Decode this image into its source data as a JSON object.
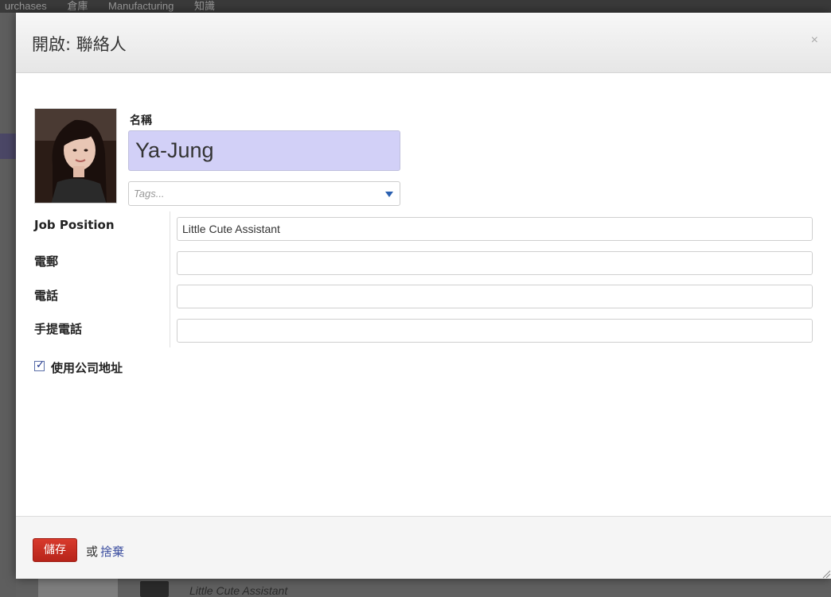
{
  "background": {
    "menu_items": [
      "urchases",
      "倉庫",
      "Manufacturing",
      "知識"
    ],
    "card_subtitle": "Little Cute Assistant"
  },
  "dialog": {
    "title": "開啟: 聯絡人",
    "close_label": "×"
  },
  "form": {
    "name_label": "名稱",
    "name_value": "Ya-Jung",
    "tags_placeholder": "Tags...",
    "fields": [
      {
        "label": "Job Position",
        "value": "Little Cute Assistant"
      },
      {
        "label": "電郵",
        "value": ""
      },
      {
        "label": "電話",
        "value": ""
      },
      {
        "label": "手提電話",
        "value": ""
      }
    ],
    "use_company_address": {
      "label": "使用公司地址",
      "checked": true
    }
  },
  "footer": {
    "save_label": "儲存",
    "or_text": "或",
    "discard_label": "捨棄"
  },
  "colors": {
    "save_button": "#c8291e",
    "name_field_bg": "#d2d0f7",
    "link": "#3d4fa0"
  }
}
